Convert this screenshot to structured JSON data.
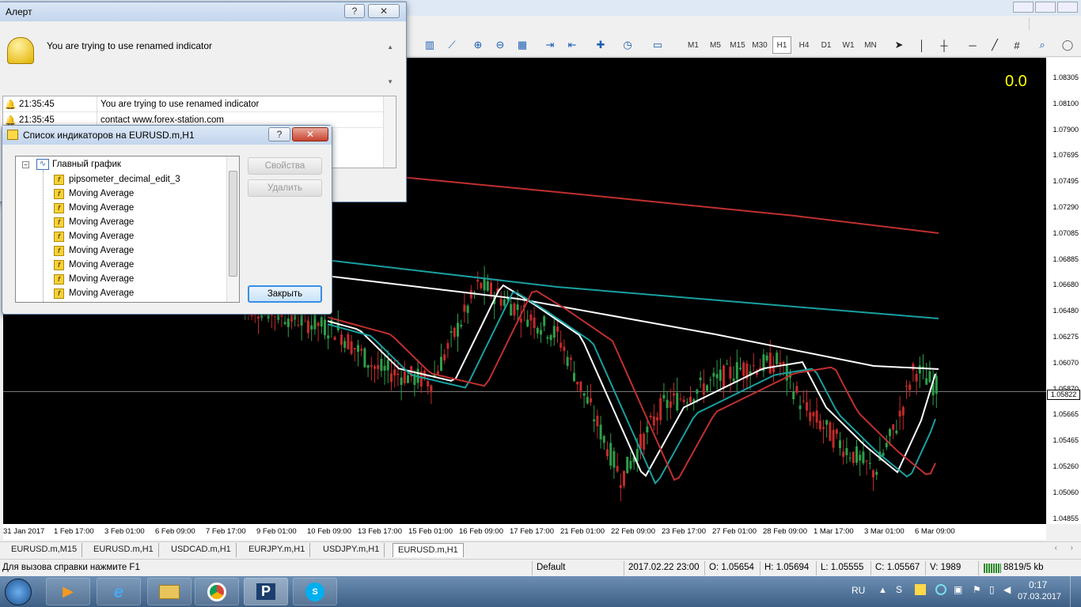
{
  "toolbar": {
    "timeframes": [
      "M1",
      "M5",
      "M15",
      "M30",
      "H1",
      "H4",
      "D1",
      "W1",
      "MN"
    ],
    "active_timeframe": "H1"
  },
  "chart": {
    "indicator_value": "0.0",
    "current_price": "1.05822",
    "y_ticks": [
      "1.08305",
      "1.08100",
      "1.07900",
      "1.07695",
      "1.07495",
      "1.07290",
      "1.07085",
      "1.06885",
      "1.06680",
      "1.06480",
      "1.06275",
      "1.06070",
      "1.05870",
      "1.05665",
      "1.05465",
      "1.05260",
      "1.05060",
      "1.04855"
    ],
    "x_ticks": [
      "31 Jan 2017",
      "1 Feb 17:00",
      "3 Feb 01:00",
      "6 Feb 09:00",
      "7 Feb 17:00",
      "9 Feb 01:00",
      "10 Feb 09:00",
      "13 Feb 17:00",
      "15 Feb 01:00",
      "16 Feb 09:00",
      "17 Feb 17:00",
      "21 Feb 01:00",
      "22 Feb 09:00",
      "23 Feb 17:00",
      "27 Feb 01:00",
      "28 Feb 09:00",
      "1 Mar 17:00",
      "3 Mar 01:00",
      "6 Mar 09:00"
    ],
    "colors": {
      "background": "#000000",
      "candle_up": "#2e9e4a",
      "candle_down": "#c42a2a",
      "ma_white": "#ffffff",
      "ma_teal": "#1aa0a0",
      "ma_red": "#c0302f",
      "indicator_text": "#ffff00"
    }
  },
  "alert": {
    "title": "Алерт",
    "message": "You are trying to use renamed indicator",
    "log": [
      {
        "time": "21:35:45",
        "text": "You are trying to use renamed indicator"
      },
      {
        "time": "21:35:45",
        "text": "contact www.forex-station.com"
      }
    ]
  },
  "indicators_dialog": {
    "title": "Список индикаторов на EURUSD.m,H1",
    "root": "Главный график",
    "items": [
      "pipsometer_decimal_edit_3",
      "Moving Average",
      "Moving Average",
      "Moving Average",
      "Moving Average",
      "Moving Average",
      "Moving Average",
      "Moving Average",
      "Moving Average"
    ],
    "properties_button": "Свойства",
    "delete_button": "Удалить",
    "close_button": "Закрыть"
  },
  "chart_tabs": [
    "EURUSD.m,M15",
    "EURUSD.m,H1",
    "USDCAD.m,H1",
    "EURJPY.m,H1",
    "USDJPY.m,H1",
    "EURUSD.m,H1"
  ],
  "active_tab_index": 5,
  "status": {
    "help": "Для вызова справки нажмите F1",
    "profile": "Default",
    "datetime": "2017.02.22 23:00",
    "open": "O: 1.05654",
    "high": "H: 1.05694",
    "low": "L: 1.05555",
    "close": "C: 1.05567",
    "volume": "V: 1989",
    "traffic": "8819/5 kb"
  },
  "taskbar": {
    "lang": "RU",
    "time": "0:17",
    "date": "07.03.2017"
  }
}
